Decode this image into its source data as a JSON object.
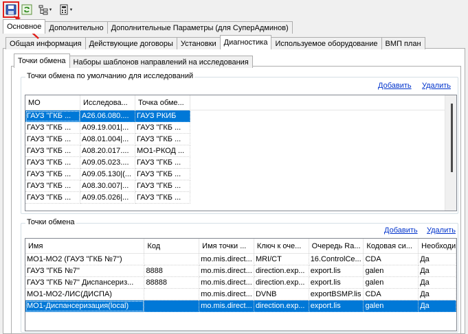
{
  "toolbar": {
    "save_icon": "save-icon",
    "refresh_icon": "refresh-icon",
    "tree_icon": "tree-icon",
    "calc_icon": "calculator-icon",
    "dropdown_glyph": "▾"
  },
  "tabs_main": [
    "Основное",
    "Дополнительно",
    "Дополнительные Параметры (для СуперАдминов)"
  ],
  "tabs_sub": [
    "Общая информация",
    "Действующие договоры",
    "Установки",
    "Диагностика",
    "Используемое оборудование",
    "ВМП план"
  ],
  "tabs_diag": [
    "Точки обмена",
    "Наборы шаблонов направлений на исследования"
  ],
  "default_points": {
    "title": "Точки обмена по умолчанию для исследований",
    "add_label": "Добавить",
    "delete_label": "Удалить",
    "columns": [
      "МО",
      "Исследова...",
      "Точка обме..."
    ],
    "rows": [
      [
        "ГАУЗ \"ГКБ ...",
        "A26.06.080....",
        "ГАУЗ РКИБ"
      ],
      [
        "ГАУЗ \"ГКБ ...",
        "A09.19.001|...",
        "ГАУЗ \"ГКБ ..."
      ],
      [
        "ГАУЗ \"ГКБ ...",
        "A08.01.004|...",
        "ГАУЗ \"ГКБ ..."
      ],
      [
        "ГАУЗ \"ГКБ ...",
        "A08.20.017....",
        "МО1-РКОД ..."
      ],
      [
        "ГАУЗ \"ГКБ ...",
        "A09.05.023....",
        "ГАУЗ \"ГКБ ..."
      ],
      [
        "ГАУЗ \"ГКБ ...",
        "A09.05.130|(...",
        "ГАУЗ \"ГКБ ..."
      ],
      [
        "ГАУЗ \"ГКБ ...",
        "A08.30.007|...",
        "ГАУЗ \"ГКБ ..."
      ],
      [
        "ГАУЗ \"ГКБ ...",
        "A09.05.026|...",
        "ГАУЗ \"ГКБ ..."
      ]
    ]
  },
  "exchange_points": {
    "title": "Точки обмена",
    "add_label": "Добавить",
    "delete_label": "Удалить",
    "columns": [
      "Имя",
      "Код",
      "Имя точки ...",
      "Ключ к оче...",
      "Очередь Ra...",
      "Кодовая си...",
      "Необходи"
    ],
    "rows": [
      [
        "МО1-МО2 (ГАУЗ \"ГКБ №7\")",
        "",
        "mo.mis.direct...",
        "MRI/CT",
        "16.ControlCe...",
        "CDA",
        "Да"
      ],
      [
        "ГАУЗ \"ГКБ №7\"",
        "8888",
        "mo.mis.direct...",
        "direction.exp...",
        "export.lis",
        "galen",
        "Да"
      ],
      [
        "ГАУЗ \"ГКБ №7\" Диспансериз...",
        "88888",
        "mo.mis.direct...",
        "direction.exp...",
        "export.lis",
        "galen",
        "Да"
      ],
      [
        "МО1-МО2-ЛИС(ДИСПА)",
        "",
        "mo.mis.direct...",
        "DVNB",
        "exportBSMP.lis",
        "CDA",
        "Да"
      ],
      [
        "МО1-Диспансеризация(local)",
        "",
        "mo.mis.direct...",
        "direction.exp...",
        "export.lis",
        "galen",
        "Да"
      ]
    ]
  }
}
